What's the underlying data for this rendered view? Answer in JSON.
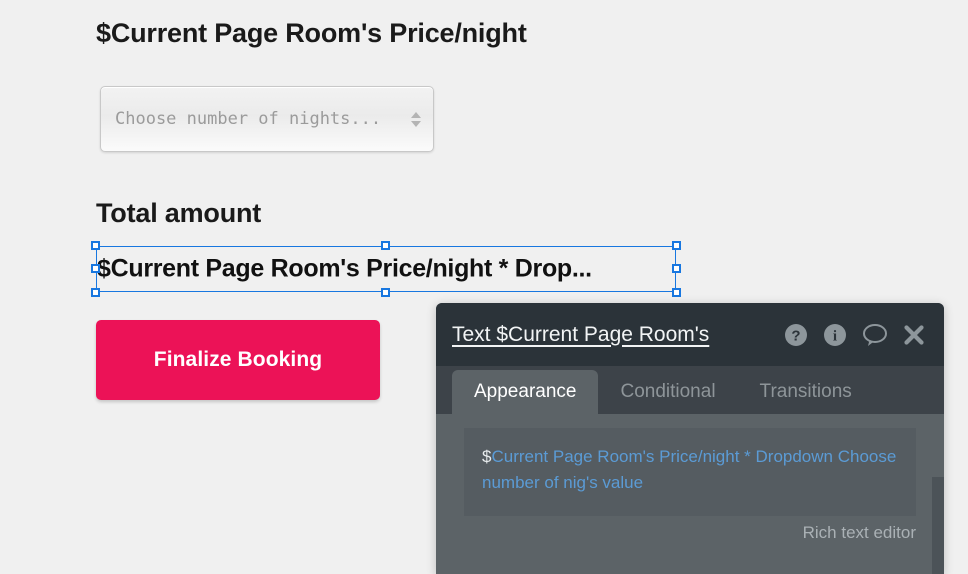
{
  "page": {
    "background_color": "#f0f0f0",
    "price_heading": "$Current Page Room's Price/night",
    "total_heading": "Total amount"
  },
  "nights_dropdown": {
    "placeholder": "Choose number of nights...",
    "value": "",
    "spinner_icon": "up-down-arrows-icon"
  },
  "selected_element": {
    "text": "$Current Page Room's Price/night * Drop...",
    "selection_color": "#1877e0",
    "handle_fill": "#ffffff"
  },
  "finalize_button": {
    "label": "Finalize Booking",
    "color": "#ec1257",
    "text_color": "#ffffff"
  },
  "property_panel": {
    "title": "Text $Current Page Room's",
    "header_color": "#2b3339",
    "body_color": "#5c6367",
    "icons": {
      "help": "help-circle-icon",
      "info": "info-circle-icon",
      "comment": "comment-bubble-icon",
      "close": "close-x-icon"
    },
    "tabs": [
      {
        "label": "Appearance",
        "active": true
      },
      {
        "label": "Conditional",
        "active": false
      },
      {
        "label": "Transitions",
        "active": false
      }
    ],
    "rich_text": {
      "dollar_prefix": "$",
      "content": "Current Page Room's Price/night * Dropdown Choose number of nig's value",
      "caption": "Rich text editor",
      "text_color": "#5b9bd5"
    }
  }
}
